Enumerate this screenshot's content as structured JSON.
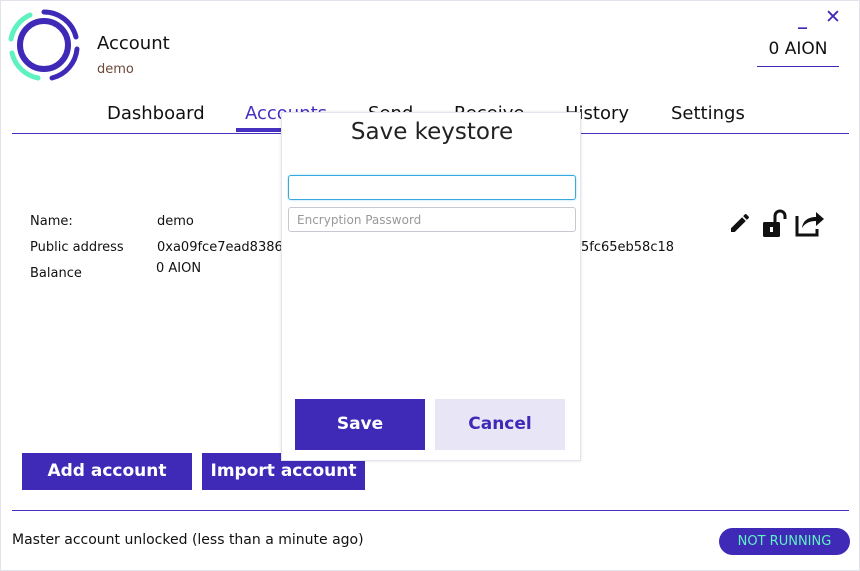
{
  "header": {
    "title": "Account",
    "subtitle": "demo",
    "balance": "0 AION",
    "minimize_glyph": "_",
    "close_glyph": "✕"
  },
  "tabs": [
    {
      "label": "Dashboard"
    },
    {
      "label": "Accounts"
    },
    {
      "label": "Send"
    },
    {
      "label": "Receive"
    },
    {
      "label": "History"
    },
    {
      "label": "Settings"
    }
  ],
  "active_tab": "Accounts",
  "account_info": {
    "name_label": "Name:",
    "name_value": "demo",
    "address_label": "Public address",
    "address_start": "0xa09fce7ead8386",
    "address_end": "5fc65eb58c18",
    "balance_label": "Balance",
    "balance_value": "0 AION"
  },
  "icons": [
    "edit-icon",
    "unlock-icon",
    "export-icon"
  ],
  "buttons": {
    "add_account": "Add account",
    "import_account": "Import account"
  },
  "footer": {
    "status": "Master account unlocked (less than a minute ago)",
    "node_status": "NOT RUNNING"
  },
  "modal": {
    "title": "Save keystore",
    "first_input_value": "",
    "password_placeholder": "Encryption Password",
    "save_label": "Save",
    "cancel_label": "Cancel"
  },
  "colors": {
    "brand": "#3f2ab8",
    "accent_teal": "#5ef2c0",
    "focus_blue": "#35a9e0"
  }
}
